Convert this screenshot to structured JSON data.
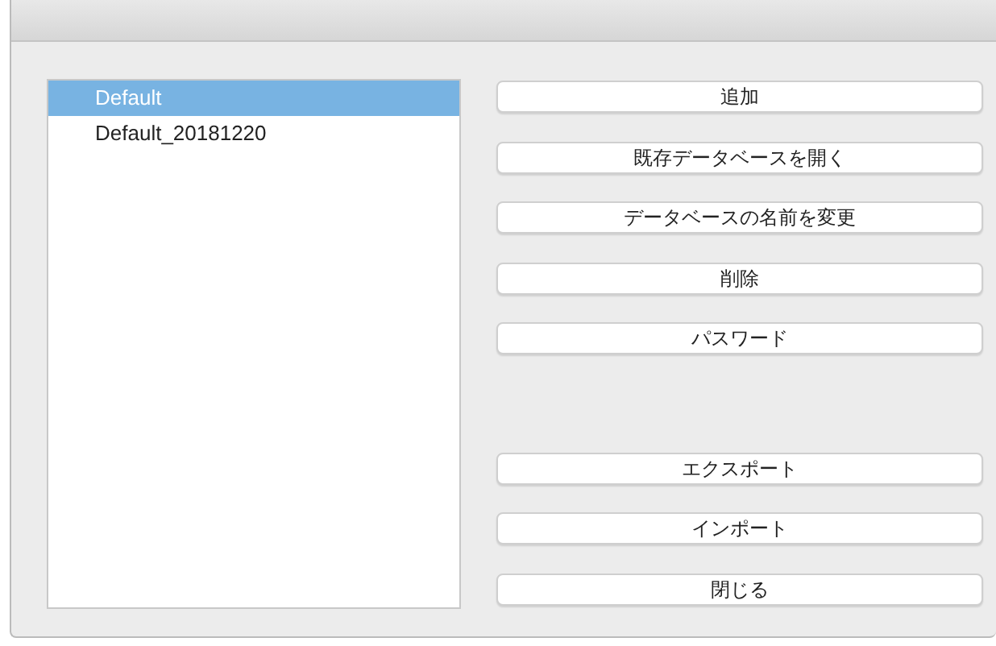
{
  "databases": [
    {
      "label": "Default",
      "selected": true
    },
    {
      "label": "Default_20181220",
      "selected": false
    }
  ],
  "buttons_top": [
    "追加",
    "既存データベースを開く",
    "データベースの名前を変更",
    "削除",
    "パスワード"
  ],
  "buttons_bottom": [
    "エクスポート",
    "インポート",
    "閉じる"
  ]
}
